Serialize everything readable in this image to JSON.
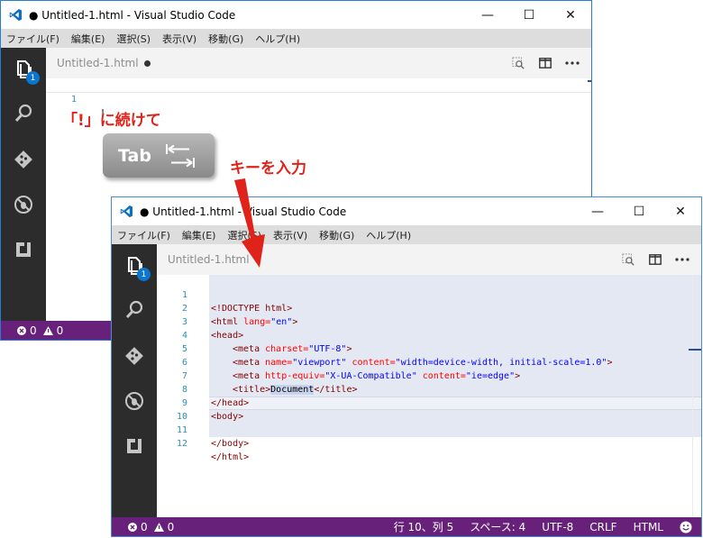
{
  "app": {
    "window_title": "● Untitled-1.html - Visual Studio Code",
    "window_title_2": "● Untitled-1.html - Visual Studio Code"
  },
  "window_controls": {
    "minimize": "—",
    "maximize": "☐",
    "close": "✕"
  },
  "menu": [
    "ファイル(F)",
    "編集(E)",
    "選択(S)",
    "表示(V)",
    "移動(G)",
    "ヘルプ(H)"
  ],
  "activity": {
    "explorer_badge": "1"
  },
  "tab": {
    "label": "Untitled-1.html"
  },
  "editor1": {
    "line_no": "1",
    "text": "!"
  },
  "annotations": {
    "step1": "「!」に続けて",
    "tab_key": "Tab",
    "step2": "キーを入力"
  },
  "code": {
    "line_numbers": [
      "1",
      "2",
      "3",
      "4",
      "5",
      "6",
      "7",
      "8",
      "9",
      "10",
      "11",
      "12"
    ],
    "doctype": "<!DOCTYPE html>",
    "html_open": "<html",
    "lang_attr": " lang=",
    "lang_val": "\"en\"",
    "gt": ">",
    "head_open": "<head>",
    "meta": "<meta",
    "charset_attr": " charset=",
    "charset_val": "\"UTF-8\"",
    "name_attr": " name=",
    "name_val": "\"viewport\"",
    "content_attr": " content=",
    "content_val": "\"width=device-width, initial-scale=1.0\"",
    "equiv_attr": " http-equiv=",
    "equiv_val": "\"X-UA-Compatible\"",
    "content_val2": "\"ie=edge\"",
    "title_open": "<title>",
    "title_text": "Document",
    "title_close": "</title>",
    "head_close": "</head>",
    "body_open": "<body>",
    "body_close": "</body>",
    "html_close": "</html>"
  },
  "status": {
    "errors": "0",
    "warnings": "0",
    "position": "行 10、列 5",
    "spaces": "スペース: 4",
    "encoding": "UTF-8",
    "eol": "CRLF",
    "language": "HTML"
  },
  "colors": {
    "statusbar": "#68217a",
    "activitybar": "#2c2c2c",
    "annotation": "#e0231a",
    "badge": "#0a76d0"
  }
}
